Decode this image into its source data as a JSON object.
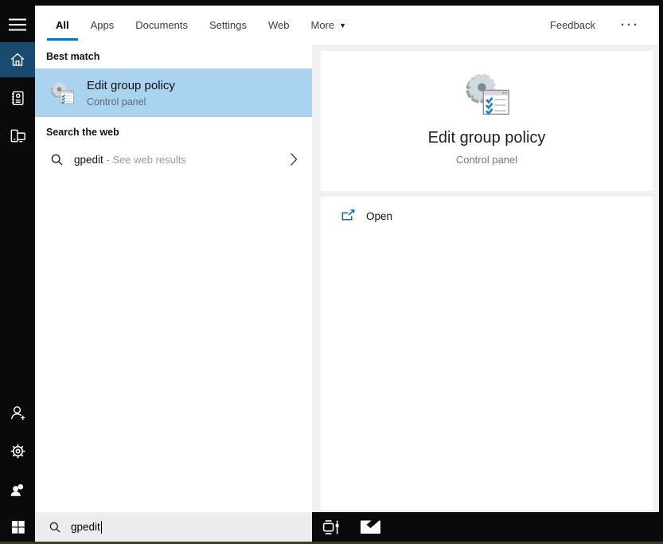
{
  "colors": {
    "accent_blue": "#0078d7",
    "highlight_blue": "#aad3f0",
    "home_tile_blue": "#1b4a71",
    "open_icon_blue": "#1566b0",
    "sidebar_black": "#0a0a0a",
    "panel_gray": "#f1f1f1",
    "search_box_gray": "#ececec",
    "bottom_edge_brown": "#473823"
  },
  "tabs": {
    "items": [
      {
        "label": "All",
        "active": true
      },
      {
        "label": "Apps",
        "active": false
      },
      {
        "label": "Documents",
        "active": false
      },
      {
        "label": "Settings",
        "active": false
      },
      {
        "label": "Web",
        "active": false
      },
      {
        "label": "More",
        "active": false,
        "has_dropdown": true
      }
    ],
    "feedback_label": "Feedback",
    "overflow_label": "···"
  },
  "sidebar": {
    "items": [
      {
        "icon": "menu-icon"
      },
      {
        "icon": "home-icon",
        "active": true
      },
      {
        "icon": "journal-icon"
      },
      {
        "icon": "devices-icon"
      },
      {
        "icon": "add-user-icon"
      },
      {
        "icon": "settings-gear-icon"
      },
      {
        "icon": "feedback-person-icon"
      }
    ]
  },
  "results": {
    "best_match_header": "Best match",
    "best_match": {
      "icon": "gpedit-icon",
      "title": "Edit group policy",
      "subtitle": "Control panel"
    },
    "web_header": "Search the web",
    "web_result": {
      "icon": "search-icon",
      "query": "gpedit",
      "suffix": " - See web results",
      "trailing_icon": "chevron-right-icon"
    }
  },
  "preview": {
    "icon": "gpedit-icon",
    "title": "Edit group policy",
    "subtitle": "Control panel",
    "actions": [
      {
        "icon": "open-external-icon",
        "label": "Open"
      }
    ]
  },
  "taskbar": {
    "start_icon": "windows-start-icon",
    "search_icon": "search-icon",
    "search_value": "gpedit",
    "tray": [
      {
        "icon": "task-view-icon"
      },
      {
        "icon": "mail-icon"
      }
    ]
  }
}
